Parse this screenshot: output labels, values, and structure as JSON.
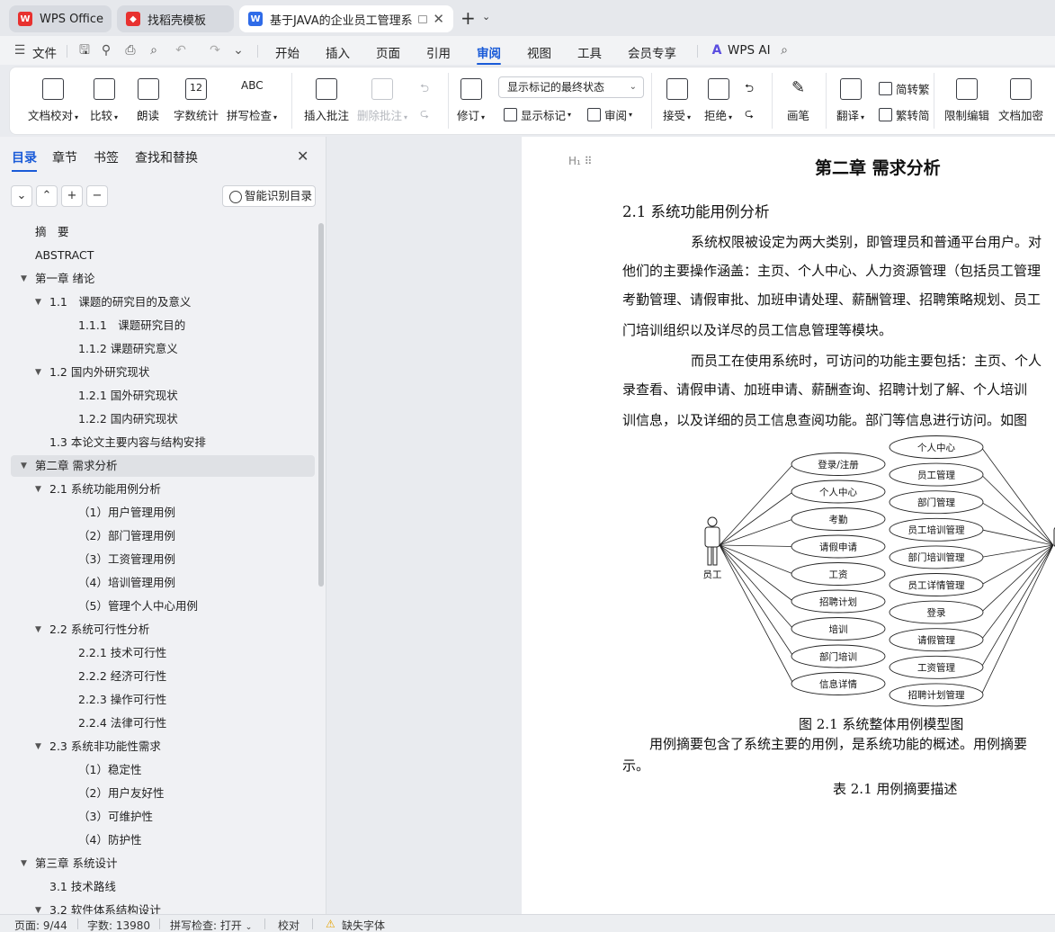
{
  "tabs": [
    {
      "label": "WPS Office",
      "icon": "wps-logo-icon",
      "color": "#e8312f"
    },
    {
      "label": "找稻壳模板",
      "icon": "docer-icon",
      "color": "#e8312f"
    },
    {
      "label": "基于JAVA的企业员工管理系统",
      "icon": "writer-doc-icon",
      "color": "#2f6be8"
    }
  ],
  "menubar": {
    "file": "文件",
    "items": [
      "开始",
      "插入",
      "页面",
      "引用",
      "审阅",
      "视图",
      "工具",
      "会员专享"
    ],
    "active": "审阅",
    "wps_ai": "WPS AI"
  },
  "ribbon": {
    "doc_check": "文档校对",
    "compare": "比较",
    "read_aloud": "朗读",
    "word_count": "字数统计",
    "spell_check": "拼写检查",
    "spell_icon_text": "ABC",
    "insert_comment": "插入批注",
    "delete_comment": "删除批注",
    "track_changes": "修订",
    "markup_state": "显示标记的最终状态",
    "show_markup": "显示标记",
    "review": "审阅",
    "accept": "接受",
    "reject": "拒绝",
    "pen": "画笔",
    "translate": "翻译",
    "to_traditional": "简转繁",
    "to_simplified": "繁转简",
    "restrict_edit": "限制编辑",
    "encrypt_doc": "文档加密"
  },
  "sidebar": {
    "tabs": [
      "目录",
      "章节",
      "书签",
      "查找和替换"
    ],
    "smart_toc": "智能识别目录",
    "toc": [
      {
        "label": "摘　要",
        "level": 0,
        "arrow": false
      },
      {
        "label": "ABSTRACT",
        "level": 0,
        "arrow": false
      },
      {
        "label": "第一章  绪论",
        "level": 0,
        "arrow": true
      },
      {
        "label": "1.1　课题的研究目的及意义",
        "level": 1,
        "arrow": true
      },
      {
        "label": "1.1.1　课题研究目的",
        "level": 2,
        "arrow": false
      },
      {
        "label": "1.1.2  课题研究意义",
        "level": 2,
        "arrow": false
      },
      {
        "label": "1.2  国内外研究现状",
        "level": 1,
        "arrow": true
      },
      {
        "label": "1.2.1  国外研究现状",
        "level": 2,
        "arrow": false
      },
      {
        "label": "1.2.2  国内研究现状",
        "level": 2,
        "arrow": false
      },
      {
        "label": "1.3  本论文主要内容与结构安排",
        "level": 1,
        "arrow": false
      },
      {
        "label": "第二章  需求分析",
        "level": 0,
        "arrow": true,
        "selected": true
      },
      {
        "label": "2.1  系统功能用例分析",
        "level": 1,
        "arrow": true
      },
      {
        "label": "（1）用户管理用例",
        "level": 2,
        "arrow": false
      },
      {
        "label": "（2）部门管理用例",
        "level": 2,
        "arrow": false
      },
      {
        "label": "（3）工资管理用例",
        "level": 2,
        "arrow": false
      },
      {
        "label": "（4）培训管理用例",
        "level": 2,
        "arrow": false
      },
      {
        "label": "（5）管理个人中心用例",
        "level": 2,
        "arrow": false
      },
      {
        "label": "2.2  系统可行性分析",
        "level": 1,
        "arrow": true
      },
      {
        "label": "2.2.1  技术可行性",
        "level": 2,
        "arrow": false
      },
      {
        "label": "2.2.2  经济可行性",
        "level": 2,
        "arrow": false
      },
      {
        "label": "2.2.3  操作可行性",
        "level": 2,
        "arrow": false
      },
      {
        "label": "2.2.4  法律可行性",
        "level": 2,
        "arrow": false
      },
      {
        "label": "2.3  系统非功能性需求",
        "level": 1,
        "arrow": true
      },
      {
        "label": "（1）稳定性",
        "level": 2,
        "arrow": false
      },
      {
        "label": "（2）用户友好性",
        "level": 2,
        "arrow": false
      },
      {
        "label": "（3）可维护性",
        "level": 2,
        "arrow": false
      },
      {
        "label": "（4）防护性",
        "level": 2,
        "arrow": false
      },
      {
        "label": "第三章  系统设计",
        "level": 0,
        "arrow": true
      },
      {
        "label": "3.1  技术路线",
        "level": 1,
        "arrow": false
      },
      {
        "label": "3.2  软件体系结构设计",
        "level": 1,
        "arrow": true
      }
    ]
  },
  "document": {
    "handle": "H₁",
    "heading1": "第二章  需求分析",
    "heading2": "2.1  系统功能用例分析",
    "para1": [
      "系统权限被设定为两大类别，即管理员和普通平台用户。对",
      "他们的主要操作涵盖：主页、个人中心、人力资源管理（包括员工管理",
      "考勤管理、请假审批、加班申请处理、薪酬管理、招聘策略规划、员工",
      "门培训组织以及详尽的员工信息管理等模块。"
    ],
    "para2": [
      "而员工在使用系统时，可访问的功能主要包括：主页、个人",
      "录查看、请假申请、加班申请、薪酬查询、招聘计划了解、个人培训",
      "训信息，以及详细的员工信息查阅功能。部门等信息进行访问。如图"
    ],
    "diagram": {
      "actor_left": "员工",
      "actor_right": "管",
      "left_cases": [
        "登录/注册",
        "个人中心",
        "考勤",
        "请假申请",
        "工资",
        "招聘计划",
        "培训",
        "部门培训",
        "信息详情"
      ],
      "right_cases": [
        "个人中心",
        "员工管理",
        "部门管理",
        "员工培训管理",
        "部门培训管理",
        "员工详情管理",
        "登录",
        "请假管理",
        "工资管理",
        "招聘计划管理"
      ]
    },
    "figure_caption": "图 2.1  系统整体用例模型图",
    "para3": [
      "用例摘要包含了系统主要的用例，是系统功能的概述。用例摘要",
      "示。"
    ],
    "table_caption": "表 2.1  用例摘要描述"
  },
  "statusbar": {
    "page": "页面: 9/44",
    "words": "字数: 13980",
    "spell": "拼写检查: 打开",
    "proof": "校对",
    "missing_font": "缺失字体"
  }
}
